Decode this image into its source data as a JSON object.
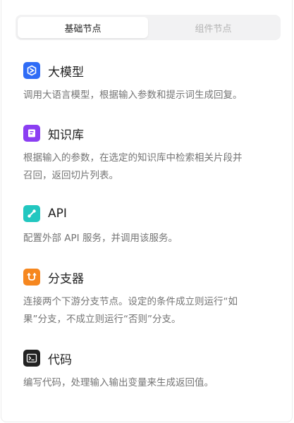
{
  "tabs": [
    {
      "label": "基础节点",
      "active": true
    },
    {
      "label": "组件节点",
      "active": false
    }
  ],
  "nodes": [
    {
      "title": "大模型",
      "desc": "调用大语言模型，根据输入参数和提示词生成回复。",
      "icon": "llm-icon",
      "color": "#2f6cf6"
    },
    {
      "title": "知识库",
      "desc_line1": "根据输入的参数，在选定的知识库中检索相关片段并",
      "desc_line2": "召回，返回切片列表。",
      "icon": "knowledge-icon",
      "color": "#8b3ef2"
    },
    {
      "title": "API",
      "desc": "配置外部 API 服务，并调用该服务。",
      "icon": "api-icon",
      "color": "#22c7c0"
    },
    {
      "title": "分支器",
      "desc_line1": "连接两个下游分支节点。设定的条件成立则运行“如",
      "desc_line2": "果”分支，不成立则运行“否则”分支。",
      "icon": "branch-icon",
      "color": "#f6871f"
    },
    {
      "title": "代码",
      "desc": "编写代码，处理输入输出变量来生成返回值。",
      "icon": "code-icon",
      "color": "#222222"
    }
  ]
}
